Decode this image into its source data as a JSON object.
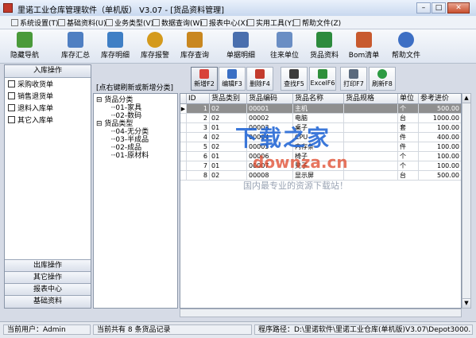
{
  "window": {
    "title": "里诺工业仓库管理软件（单机版） V3.07 - [货品资料管理]",
    "minimize": "–",
    "maximize": "□",
    "close": "✕"
  },
  "menu": [
    "系统设置(T)",
    "基础资料(U)",
    "业务类型(V)",
    "数据查询(W)",
    "报表中心(X)",
    "实用工具(Y)",
    "帮助文件(Z)"
  ],
  "toolbar": {
    "items": [
      {
        "label": "隐藏导航",
        "icon": "house-icon",
        "color": "#4a9a3a"
      },
      {
        "label": "库存汇总",
        "icon": "chart-icon",
        "color": "#4f7fc2"
      },
      {
        "label": "库存明细",
        "icon": "chart-line-icon",
        "color": "#3f7fc5"
      },
      {
        "label": "库存报警",
        "icon": "alarm-icon",
        "color": "#d49a1c"
      },
      {
        "label": "库存查询",
        "icon": "grid-icon",
        "color": "#c9871f"
      },
      {
        "label": "单据明细",
        "icon": "document-icon",
        "color": "#4a6fae"
      },
      {
        "label": "往来单位",
        "icon": "people-icon",
        "color": "#6a8ec4"
      },
      {
        "label": "货品资料",
        "icon": "box-icon",
        "color": "#2d8b3d"
      },
      {
        "label": "Bom清单",
        "icon": "bom-icon",
        "color": "#c85a2e"
      },
      {
        "label": "帮助文件",
        "icon": "help-icon",
        "color": "#3d6fc4"
      }
    ]
  },
  "left_panel": {
    "header": "入库操作",
    "items": [
      "采购收货单",
      "销售退货单",
      "退料入库单",
      "其它入库单"
    ],
    "sections": [
      "出库操作",
      "其它操作",
      "报表中心",
      "基础资料"
    ]
  },
  "hint": "[点右键刷新或新增分类]",
  "tree": {
    "groups": [
      {
        "label": "货品分类",
        "children": [
          "01-家具",
          "02-数码"
        ]
      },
      {
        "label": "货品类型",
        "children": [
          "04-无分类",
          "03-半成品",
          "02-成品",
          "01-原材料"
        ]
      }
    ]
  },
  "actions": [
    {
      "label": "新增F2",
      "icon": "add-icon",
      "color": "#d8433a"
    },
    {
      "label": "编辑F3",
      "icon": "edit-icon",
      "color": "#3a6fc4"
    },
    {
      "label": "删除F4",
      "icon": "delete-icon",
      "color": "#c33b2d"
    },
    {
      "label": "查找F5",
      "icon": "find-icon",
      "color": "#3b3b3b"
    },
    {
      "label": "ExcelF6",
      "icon": "excel-icon",
      "color": "#2f8f3b"
    },
    {
      "label": "打印F7",
      "icon": "print-icon",
      "color": "#5b6a7d"
    },
    {
      "label": "刷新F8",
      "icon": "refresh-icon",
      "color": "#2d9b43"
    }
  ],
  "grid": {
    "columns": [
      "ID",
      "货品类别",
      "货品编码",
      "货品名称",
      "货品规格",
      "单位",
      "参考进价"
    ],
    "rows": [
      [
        "1",
        "02",
        "00001",
        "主机",
        "",
        "个",
        "500.00"
      ],
      [
        "2",
        "02",
        "00002",
        "电脑",
        "",
        "台",
        "1000.00"
      ],
      [
        "3",
        "01",
        "00003",
        "桌子",
        "",
        "套",
        "100.00"
      ],
      [
        "4",
        "02",
        "00004",
        "CPU",
        "",
        "件",
        "400.00"
      ],
      [
        "5",
        "02",
        "00005",
        "内存条",
        "",
        "件",
        "100.00"
      ],
      [
        "6",
        "01",
        "00006",
        "椅子",
        "",
        "个",
        "100.00"
      ],
      [
        "7",
        "01",
        "00007",
        "凳子",
        "",
        "个",
        "100.00"
      ],
      [
        "8",
        "02",
        "00008",
        "显示屏",
        "",
        "台",
        "500.00"
      ]
    ],
    "selected_row": 0
  },
  "watermark": {
    "brand": "下载之家",
    "url": "downza.cn",
    "slogan": "国内最专业的资源下载站！"
  },
  "status": {
    "user": "当前用户：Admin",
    "records": "当前共有 8 条货品记录",
    "path": "程序路径：D:\\里诺软件\\里诺工业仓库(单机版)V3.07\\Depot3000."
  },
  "colors": {
    "accent": "#2266d6",
    "selection": "#8f8f8f"
  }
}
